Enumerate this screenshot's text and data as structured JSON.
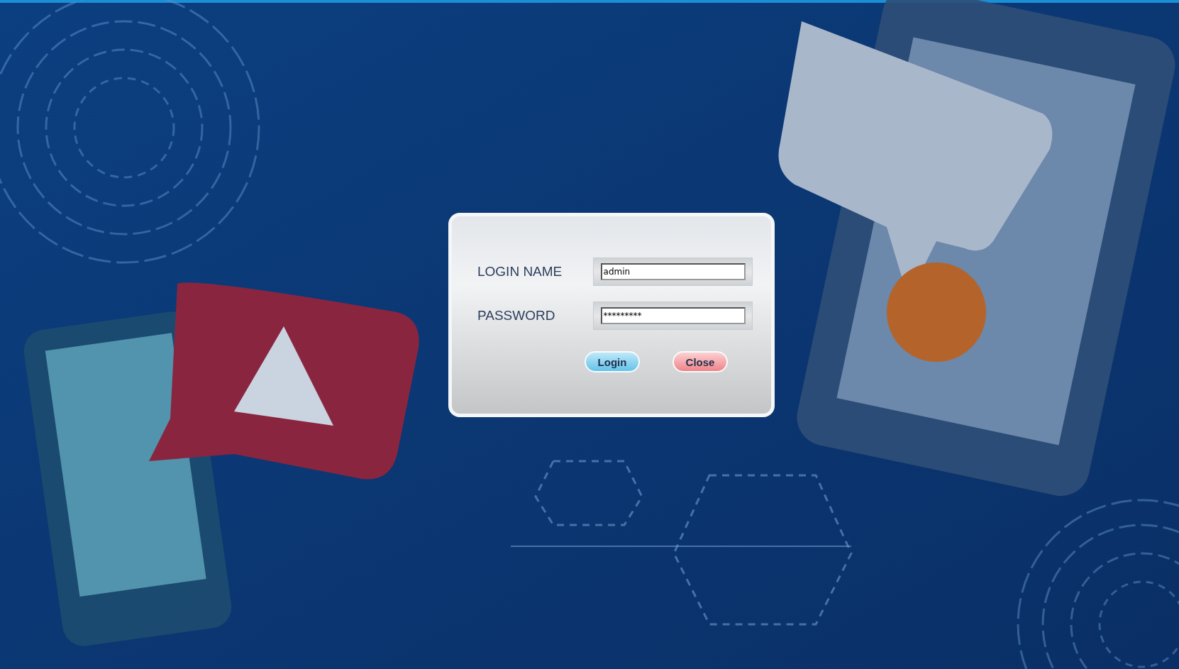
{
  "login_dialog": {
    "fields": [
      {
        "label": "LOGIN NAME",
        "value": "admin"
      },
      {
        "label": "PASSWORD",
        "value": "*********"
      }
    ],
    "buttons": [
      {
        "label": "Login",
        "kind": "primary"
      },
      {
        "label": "Close",
        "kind": "danger"
      }
    ]
  }
}
